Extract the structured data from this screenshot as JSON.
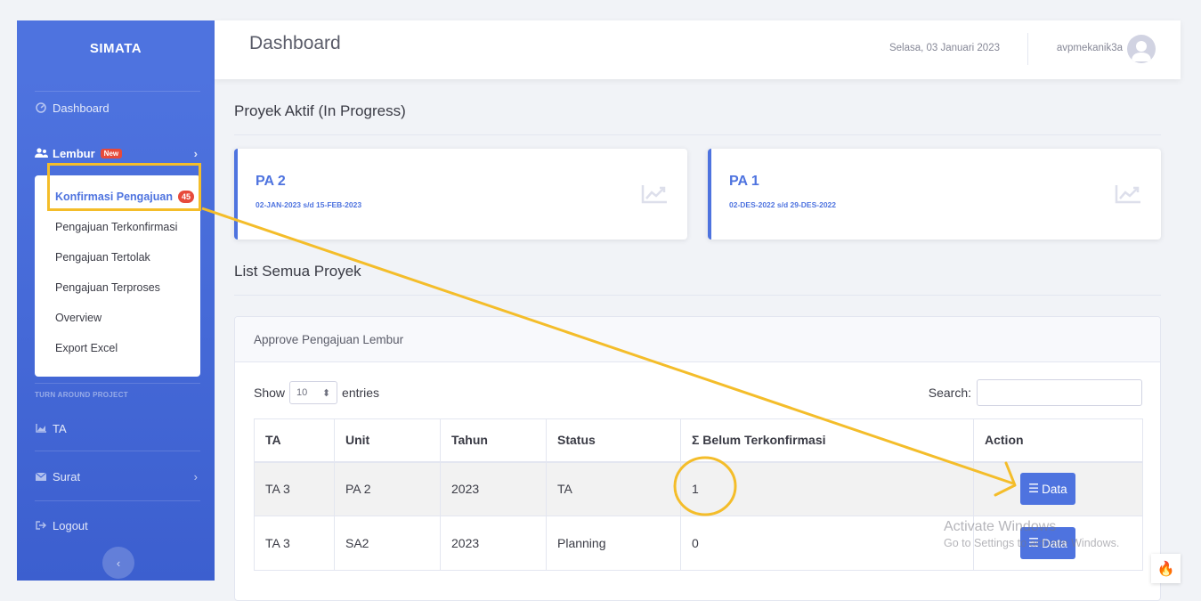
{
  "sidebar": {
    "brand": "SIMATA",
    "nav": {
      "dashboard": "Dashboard",
      "lembur": "Lembur",
      "lembur_badge": "New",
      "ta": "TA",
      "surat": "Surat",
      "logout": "Logout"
    },
    "submenu": [
      {
        "label": "Konfirmasi Pengajuan",
        "badge": "45"
      },
      {
        "label": "Pengajuan Terkonfirmasi"
      },
      {
        "label": "Pengajuan Tertolak"
      },
      {
        "label": "Pengajuan Terproses"
      },
      {
        "label": "Overview"
      },
      {
        "label": "Export Excel"
      }
    ],
    "heading": "TURN AROUND PROJECT"
  },
  "topbar": {
    "title": "Dashboard",
    "date": "Selasa, 03 Januari 2023",
    "user": "avpmekanik3a"
  },
  "content": {
    "active_title": "Proyek Aktif (In Progress)",
    "projects": [
      {
        "name": "PA 2",
        "range": "02-JAN-2023 s/d 15-FEB-2023"
      },
      {
        "name": "PA 1",
        "range": "02-DES-2022 s/d 29-DES-2022"
      }
    ],
    "list_title": "List Semua Proyek",
    "panel_title": "Approve Pengajuan Lembur",
    "show_label": "Show",
    "entries_value": "10",
    "entries_label": "entries",
    "search_label": "Search:",
    "table": {
      "headers": [
        "TA",
        "Unit",
        "Tahun",
        "Status",
        "Σ Belum Terkonfirmasi",
        "Action"
      ],
      "rows": [
        [
          "TA 3",
          "PA 2",
          "2023",
          "TA",
          "1"
        ],
        [
          "TA 3",
          "SA2",
          "2023",
          "Planning",
          "0"
        ]
      ],
      "action_label": "Data"
    }
  },
  "watermark": {
    "line1": "Activate Windows",
    "line2": "Go to Settings to activate Windows."
  },
  "colors": {
    "primary": "#4e73df",
    "annotation": "#f4bd2a",
    "danger": "#e74a3b"
  }
}
